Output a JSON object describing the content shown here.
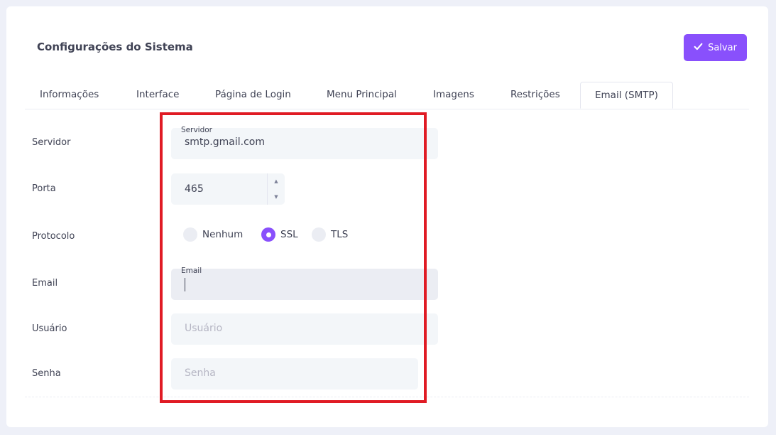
{
  "header": {
    "title": "Configurações do Sistema",
    "save_label": "Salvar"
  },
  "colors": {
    "accent": "#8950fc",
    "highlight": "#e01b24",
    "input_bg": "#f3f6f9"
  },
  "tabs": [
    {
      "label": "Informações"
    },
    {
      "label": "Interface"
    },
    {
      "label": "Página de Login"
    },
    {
      "label": "Menu Principal"
    },
    {
      "label": "Imagens"
    },
    {
      "label": "Restrições"
    },
    {
      "label": "Email (SMTP)",
      "active": true
    }
  ],
  "form": {
    "servidor": {
      "label": "Servidor",
      "floating_label": "Servidor",
      "value": "smtp.gmail.com"
    },
    "porta": {
      "label": "Porta",
      "value": "465"
    },
    "protocolo": {
      "label": "Protocolo",
      "options": [
        "Nenhum",
        "SSL",
        "TLS"
      ],
      "selected": "SSL"
    },
    "email": {
      "label": "Email",
      "floating_label": "Email",
      "value": ""
    },
    "usuario": {
      "label": "Usuário",
      "placeholder": "Usuário"
    },
    "senha": {
      "label": "Senha",
      "placeholder": "Senha"
    }
  }
}
